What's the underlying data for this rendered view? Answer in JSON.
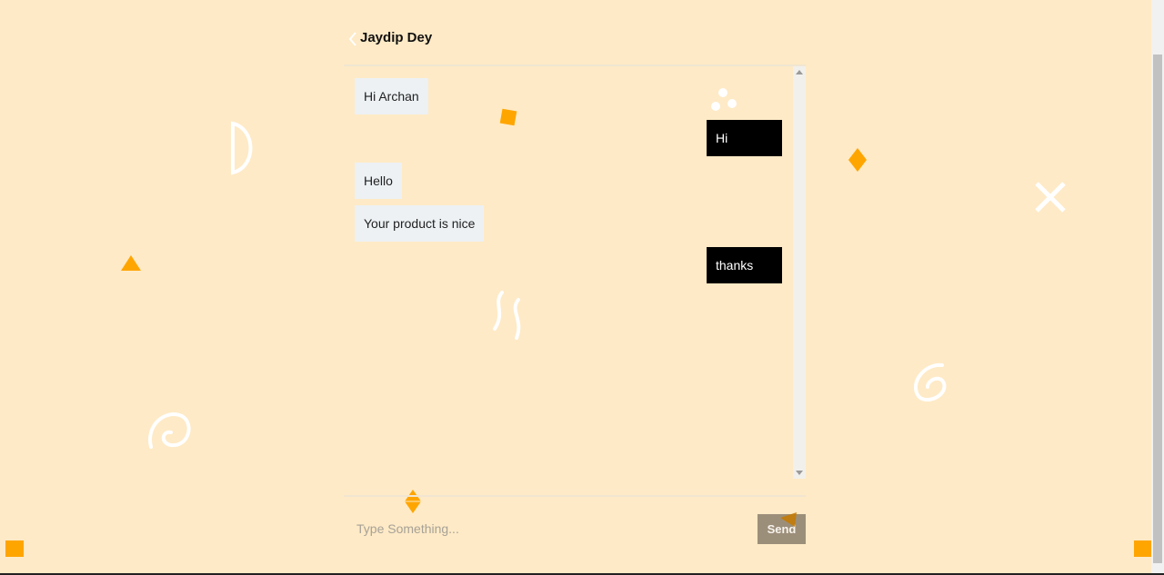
{
  "header": {
    "contact_name": "Jaydip Dey"
  },
  "messages": [
    {
      "direction": "in",
      "text": "Hi Archan"
    },
    {
      "direction": "out",
      "text": "Hi"
    },
    {
      "direction": "in",
      "text": "Hello"
    },
    {
      "direction": "in",
      "text": "Your product is nice"
    },
    {
      "direction": "out",
      "text": "thanks"
    }
  ],
  "composer": {
    "placeholder": "Type Something...",
    "value": "",
    "send_label": "Send"
  },
  "colors": {
    "background": "#feeac6",
    "incoming_bubble": "#edf1f4",
    "outgoing_bubble": "#000000",
    "accent_shape": "#ffa500",
    "send_button": "#9c8f7a"
  },
  "icons": {
    "back": "chevron-left-icon"
  }
}
